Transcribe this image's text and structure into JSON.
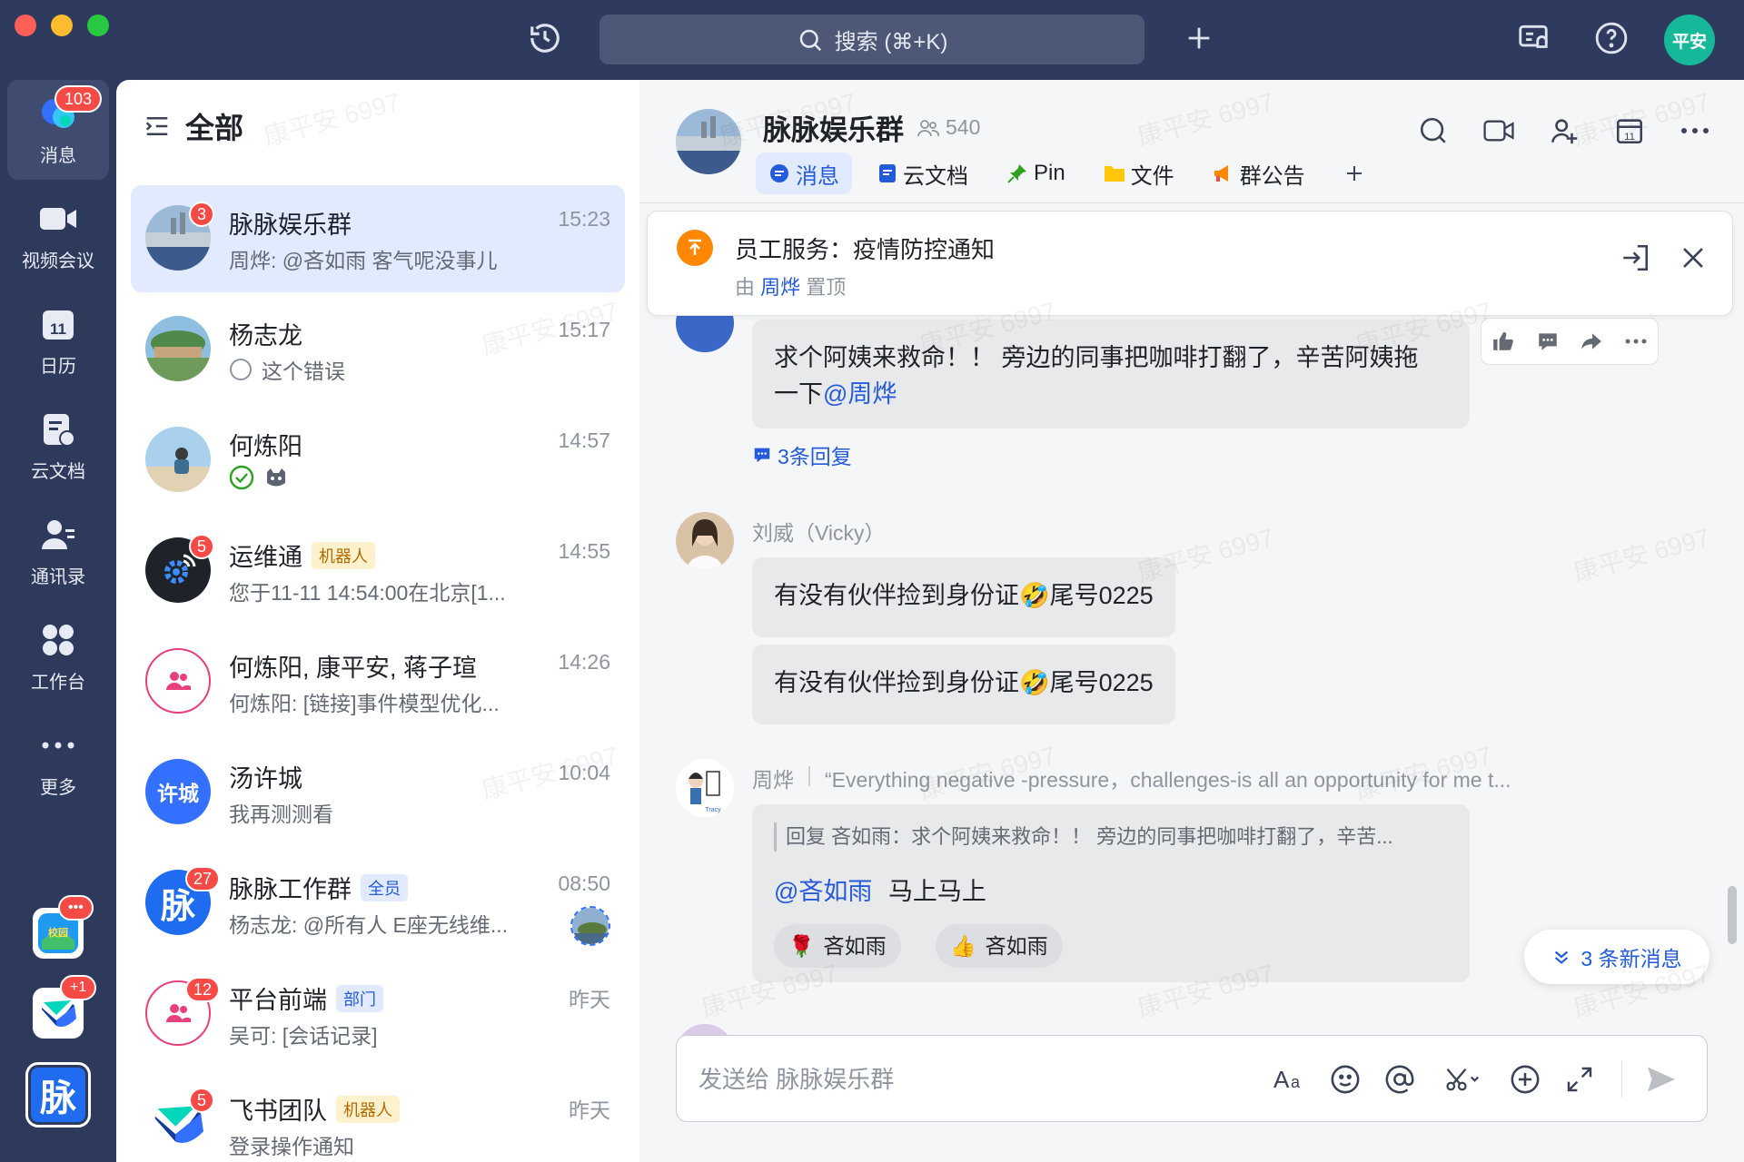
{
  "titlebar": {
    "search_placeholder": "搜索 (⌘+K)",
    "user_avatar": "平安"
  },
  "nav": {
    "items": [
      {
        "label": "消息",
        "badge": "103"
      },
      {
        "label": "视频会议"
      },
      {
        "label": "日历"
      },
      {
        "label": "云文档"
      },
      {
        "label": "通讯录"
      },
      {
        "label": "工作台"
      },
      {
        "label": "更多"
      }
    ],
    "apps": [
      {
        "name": "app-campus",
        "badge": "•••"
      },
      {
        "name": "app-feishu",
        "badge": "+1"
      },
      {
        "name": "app-maimai",
        "text": "脉"
      }
    ]
  },
  "chatlist": {
    "header": "全部",
    "chats": [
      {
        "name": "脉脉娱乐群",
        "time": "15:23",
        "preview": "周烨: @吝如雨 客气呢没事儿",
        "badge": "3",
        "tag": ""
      },
      {
        "name": "杨志龙",
        "time": "15:17",
        "preview": "这个错误",
        "badge": "",
        "tag": ""
      },
      {
        "name": "何炼阳",
        "time": "14:57",
        "preview": "",
        "badge": "",
        "tag": ""
      },
      {
        "name": "运维通",
        "time": "14:55",
        "preview": "您于11-11 14:54:00在北京[1...",
        "badge": "5",
        "tag": "机器人"
      },
      {
        "name": "何炼阳, 康平安, 蒋子瑄",
        "time": "14:26",
        "preview": "何炼阳: [链接]事件模型优化...",
        "badge": "",
        "tag": ""
      },
      {
        "name": "汤许城",
        "time": "10:04",
        "preview": "我再测测看",
        "badge": "",
        "tag": "",
        "avatar_text": "许城"
      },
      {
        "name": "脉脉工作群",
        "time": "08:50",
        "preview": "杨志龙: @所有人 E座无线维...",
        "badge": "27",
        "tag": "全员",
        "avatar_text": "脉"
      },
      {
        "name": "平台前端",
        "time": "昨天",
        "preview": "吴可: [会话记录]",
        "badge": "12",
        "tag": "部门"
      },
      {
        "name": "飞书团队",
        "time": "昨天",
        "preview": "登录操作通知",
        "badge": "5",
        "tag": "机器人"
      }
    ]
  },
  "conversation": {
    "title": "脉脉娱乐群",
    "member_count": "540",
    "tabs": [
      "消息",
      "云文档",
      "Pin",
      "文件",
      "群公告"
    ],
    "pinned": {
      "title": "员工服务：疫情防控通知",
      "by_prefix": "由",
      "by_user": "周烨",
      "by_suffix": "置顶"
    },
    "messages": [
      {
        "text_line1": "求个阿姨来救命！！ 旁边的同事把咖啡打翻了，辛苦阿姨拖",
        "text_line2_prefix": "一下",
        "mention": "@周烨",
        "replies": "3条回复"
      },
      {
        "sender": "刘威（Vicky）",
        "text_a": "有没有伙伴捡到身份证",
        "text_b": "尾号0225",
        "emoji": "🤣"
      },
      {
        "sender": "刘威（Vicky）",
        "text_a": "有没有伙伴捡到身份证",
        "text_b": "尾号0225",
        "emoji": "🤣"
      },
      {
        "sender": "周烨",
        "signature": "“Everything negative -pressure，challenges-is all an opportunity for me t...",
        "quote": "回复 吝如雨：求个阿姨来救命！！ 旁边的同事把咖啡打翻了，辛苦...",
        "mention": "@吝如雨",
        "text": "马上马上",
        "reactions": [
          {
            "emoji": "🌹",
            "user": "吝如雨"
          },
          {
            "emoji": "👍",
            "user": "吝如雨"
          }
        ]
      }
    ],
    "new_messages": "3 条新消息",
    "input_placeholder": "发送给 脉脉娱乐群"
  },
  "watermark": "康平安 6997",
  "colors": {
    "accent": "#245bdb",
    "badge": "#f54a45",
    "nav_bg": "#2d3a5c",
    "avatar_green": "#17b89a"
  }
}
